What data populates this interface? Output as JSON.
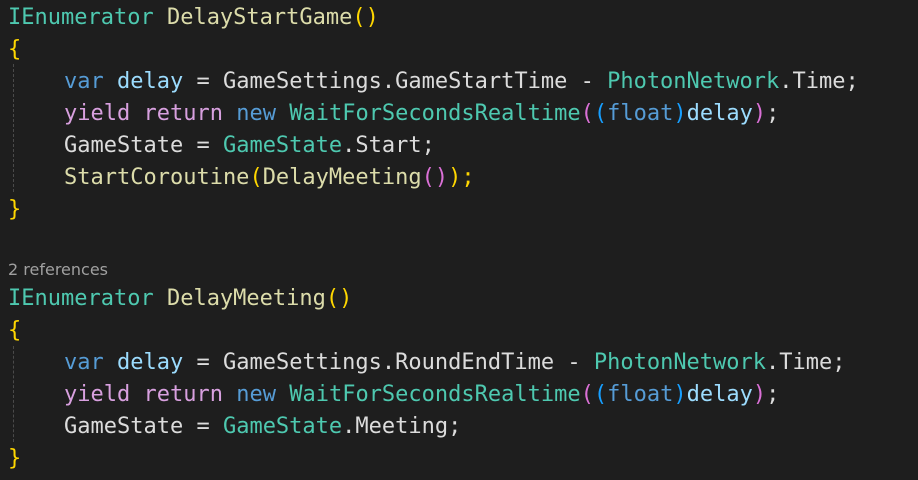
{
  "code": {
    "l1": {
      "t0": "IEnumerator",
      "t1": "DelayStartGame",
      "t2": "()"
    },
    "l2": {
      "t0": "{"
    },
    "l3": {
      "t0": "var",
      "t1": "delay",
      "t2": " = GameSettings.GameStartTime - ",
      "t3": "PhotonNetwork",
      "t4": ".Time;"
    },
    "l4": {
      "t0": "yield",
      "t1": "return",
      "t2": "new",
      "t3": "WaitForSecondsRealtime",
      "t4": "(",
      "t5": "(",
      "t6": "float",
      "t7": ")",
      "t8": "delay",
      "t9": ")",
      "t10": ";"
    },
    "l5": {
      "t0": "GameState = ",
      "t1": "GameState",
      "t2": ".Start;"
    },
    "l6": {
      "t0": "StartCoroutine",
      "t1": "(",
      "t2": "DelayMeeting",
      "t3": "()",
      "t4": ");"
    },
    "l7": {
      "t0": "}"
    },
    "lens": "2 references",
    "l8": {
      "t0": "IEnumerator",
      "t1": "DelayMeeting",
      "t2": "()"
    },
    "l9": {
      "t0": "{"
    },
    "l10": {
      "t0": "var",
      "t1": "delay",
      "t2": " = GameSettings.RoundEndTime - ",
      "t3": "PhotonNetwork",
      "t4": ".Time;"
    },
    "l11": {
      "t0": "yield",
      "t1": "return",
      "t2": "new",
      "t3": "WaitForSecondsRealtime",
      "t4": "(",
      "t5": "(",
      "t6": "float",
      "t7": ")",
      "t8": "delay",
      "t9": ")",
      "t10": ";"
    },
    "l12": {
      "t0": "GameState = ",
      "t1": "GameState",
      "t2": ".Meeting;"
    },
    "l13": {
      "t0": "}"
    }
  }
}
